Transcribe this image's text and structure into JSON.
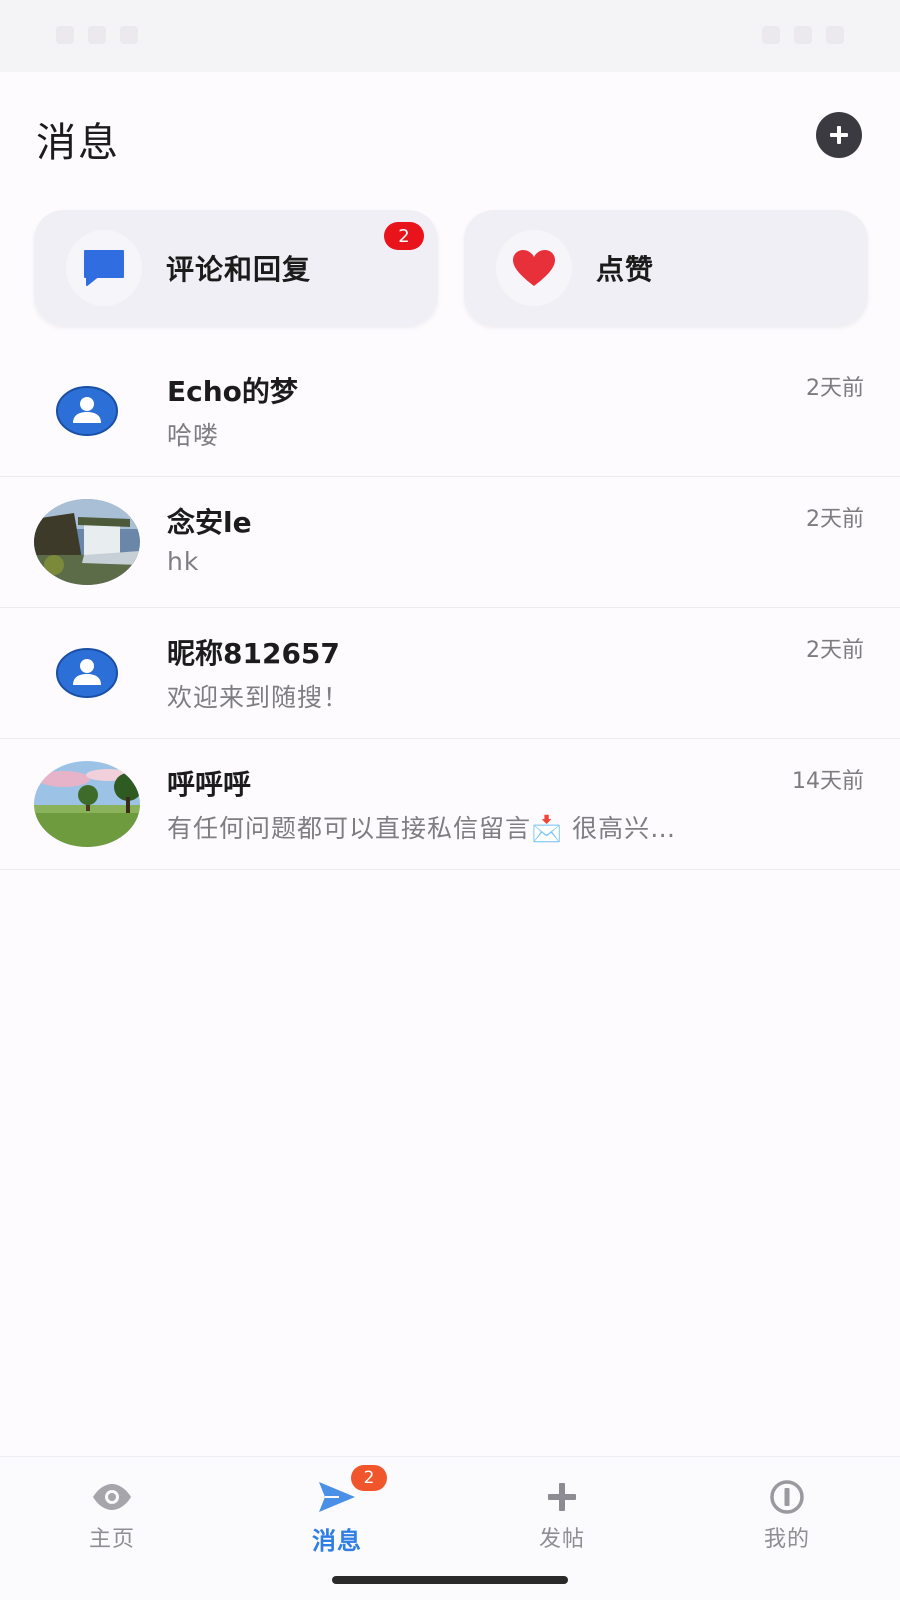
{
  "header": {
    "title": "消息",
    "add_icon": "plus-circle-icon"
  },
  "quick_cards": [
    {
      "label": "评论和回复",
      "icon": "chat-bubble-icon",
      "badge": "2",
      "icon_color": "#2f6de0"
    },
    {
      "label": "点赞",
      "icon": "heart-icon",
      "icon_color": "#e8303a"
    }
  ],
  "messages": [
    {
      "name": "Echo的梦",
      "preview": "哈喽",
      "time": "2天前",
      "avatar": "default-user-icon"
    },
    {
      "name": "念安le",
      "preview": "hk",
      "time": "2天前",
      "avatar": "waterfall-photo"
    },
    {
      "name": "昵称812657",
      "preview": "欢迎来到随搜！",
      "time": "2天前",
      "avatar": "default-user-icon"
    },
    {
      "name": "呼呼呼",
      "preview": "有任何问题都可以直接私信留言📩 很高兴…",
      "time": "14天前",
      "avatar": "meadow-tree-photo"
    }
  ],
  "tabs": [
    {
      "label": "主页",
      "icon": "eye-icon",
      "active": false
    },
    {
      "label": "消息",
      "icon": "send-icon",
      "active": true,
      "badge": "2"
    },
    {
      "label": "发帖",
      "icon": "plus-icon",
      "active": false
    },
    {
      "label": "我的",
      "icon": "info-circle-icon",
      "active": false
    }
  ],
  "colors": {
    "accent": "#2f7ee6",
    "badge_red": "#e8131b",
    "badge_orange": "#f1552b",
    "avatar_blue": "#2c6fd6"
  }
}
